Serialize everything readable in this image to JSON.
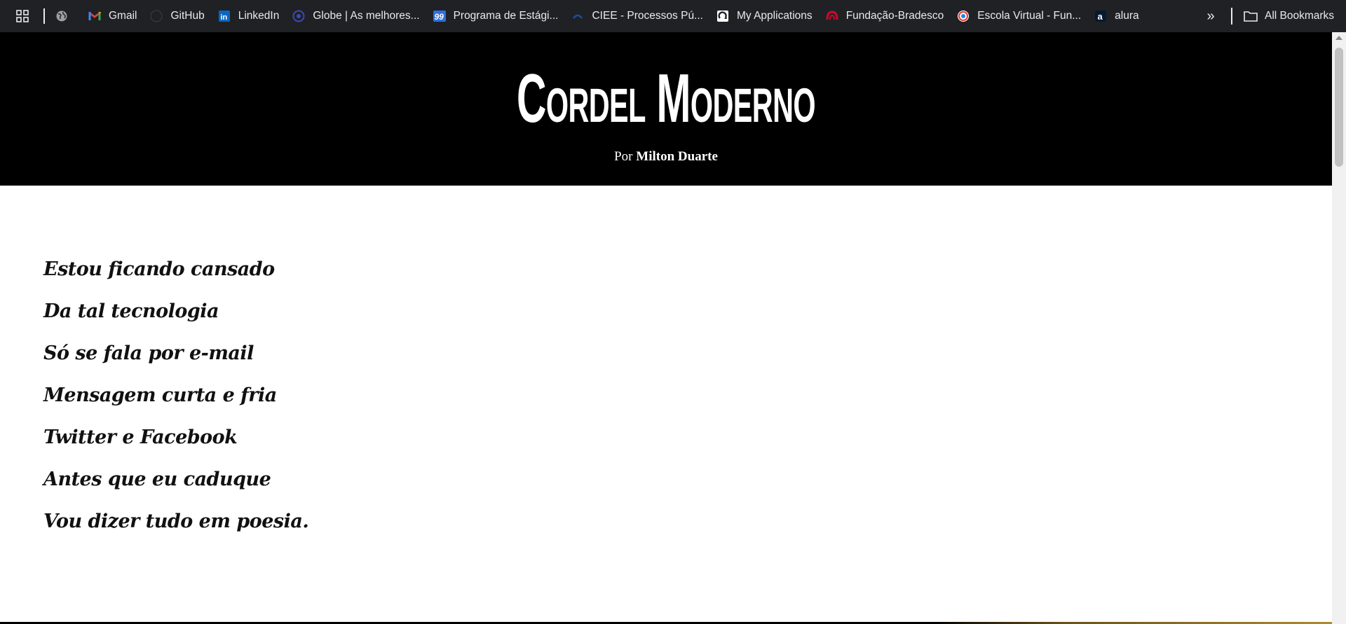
{
  "bookmarks_bar": {
    "items": [
      {
        "label": "Gmail",
        "icon": "gmail-icon"
      },
      {
        "label": "GitHub",
        "icon": "github-icon"
      },
      {
        "label": "LinkedIn",
        "icon": "linkedin-icon"
      },
      {
        "label": "Globe | As melhores...",
        "icon": "globe-site-icon"
      },
      {
        "label": "Programa de Estági...",
        "icon": "99-icon"
      },
      {
        "label": "CIEE - Processos Pú...",
        "icon": "ciee-icon"
      },
      {
        "label": "My Applications",
        "icon": "applications-icon"
      },
      {
        "label": "Fundação-Bradesco",
        "icon": "bradesco-icon"
      },
      {
        "label": "Escola Virtual - Fun...",
        "icon": "escola-virtual-icon"
      },
      {
        "label": "alura",
        "icon": "alura-icon"
      }
    ],
    "more_label": "»",
    "all_bookmarks_label": "All Bookmarks"
  },
  "header": {
    "title": "Cordel Moderno",
    "byline_prefix": "Por",
    "author": "Milton Duarte"
  },
  "poem": {
    "lines": [
      "Estou ficando cansado",
      "Da tal tecnologia",
      "Só se fala por e-mail",
      "Mensagem curta e fria",
      "Twitter e Facebook",
      "Antes que eu caduque",
      "Vou dizer tudo em poesia."
    ]
  },
  "colors": {
    "bookmarks_bg": "#202124",
    "header_bg": "#000000",
    "page_bg": "#ffffff",
    "text": "#111111"
  }
}
